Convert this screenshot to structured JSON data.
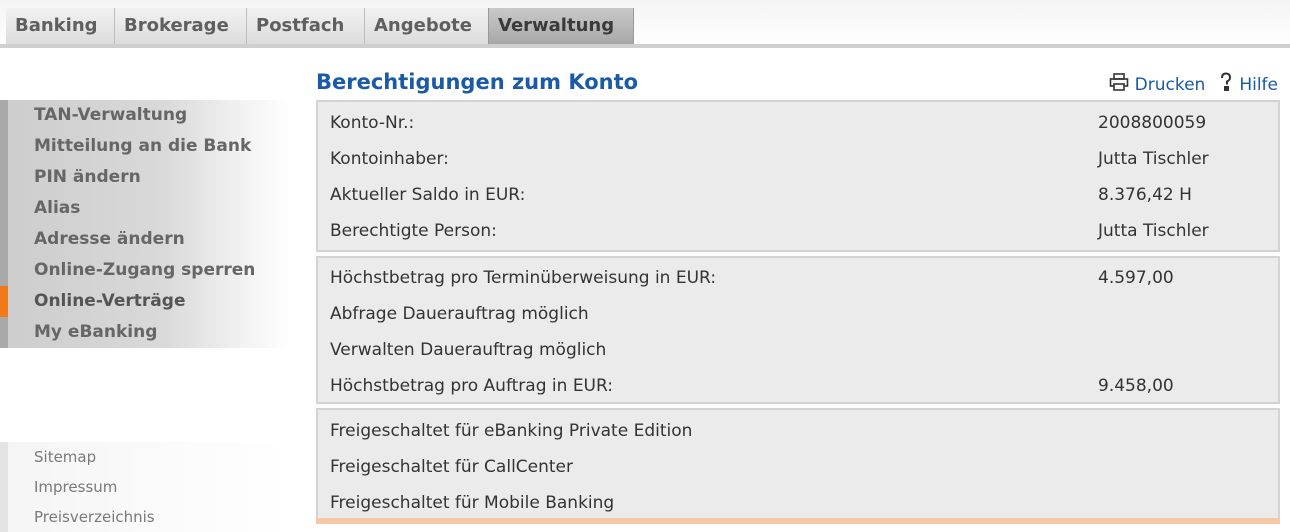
{
  "top_tabs": [
    {
      "label": "Banking"
    },
    {
      "label": "Brokerage"
    },
    {
      "label": "Postfach"
    },
    {
      "label": "Angebote"
    },
    {
      "label": "Verwaltung",
      "active": true
    }
  ],
  "sidebar": {
    "items": [
      {
        "label": "TAN-Verwaltung"
      },
      {
        "label": "Mitteilung an die Bank"
      },
      {
        "label": "PIN ändern"
      },
      {
        "label": "Alias"
      },
      {
        "label": "Adresse ändern"
      },
      {
        "label": "Online-Zugang sperren"
      },
      {
        "label": "Online-Verträge",
        "active": true
      },
      {
        "label": "My eBanking"
      }
    ],
    "footer_links": [
      {
        "label": "Sitemap"
      },
      {
        "label": "Impressum"
      },
      {
        "label": "Preisverzeichnis"
      }
    ]
  },
  "main": {
    "title": "Berechtigungen zum Konto",
    "print_label": "Drucken",
    "help_label": "Hilfe",
    "account_info": [
      {
        "label": "Konto-Nr.:",
        "value": "2008800059"
      },
      {
        "label": "Kontoinhaber:",
        "value": "Jutta Tischler"
      },
      {
        "label": "Aktueller Saldo in EUR:",
        "value": "8.376,42 H"
      },
      {
        "label": "Berechtigte Person:",
        "value": "Jutta Tischler"
      }
    ],
    "limits": [
      {
        "label": "Höchstbetrag pro Terminüberweisung in EUR:",
        "value": "4.597,00"
      },
      {
        "label": "Abfrage Dauerauftrag möglich",
        "value": ""
      },
      {
        "label": "Verwalten Dauerauftrag möglich",
        "value": ""
      },
      {
        "label": "Höchstbetrag pro Auftrag in EUR:",
        "value": "9.458,00"
      }
    ],
    "channels": [
      {
        "label": "Freigeschaltet für eBanking Private Edition"
      },
      {
        "label": "Freigeschaltet für CallCenter"
      },
      {
        "label": "Freigeschaltet für Mobile Banking"
      }
    ]
  },
  "colors": {
    "title_blue": "#1a5aa6",
    "active_orange": "#f07a1a"
  },
  "icons": {
    "print": "printer-icon",
    "help": "help-icon"
  }
}
